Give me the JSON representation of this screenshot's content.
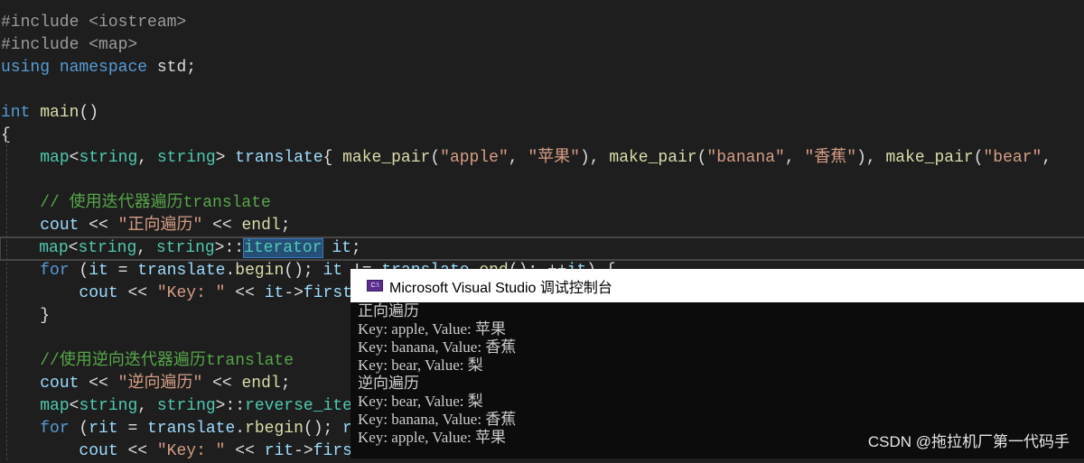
{
  "editor": {
    "lines": [
      [
        [
          "#include <iostream>",
          "pp"
        ]
      ],
      [
        [
          "#include <map>",
          "pp"
        ]
      ],
      [
        [
          "using",
          "kw"
        ],
        [
          " ",
          "pl"
        ],
        [
          "namespace",
          "kw"
        ],
        [
          " std;",
          "pl"
        ]
      ],
      [],
      [
        [
          "int",
          "kw"
        ],
        [
          " ",
          "pl"
        ],
        [
          "main",
          "fn"
        ],
        [
          "()",
          "pl"
        ]
      ],
      [
        [
          "{",
          "pl"
        ]
      ],
      [
        [
          "    ",
          "pl"
        ],
        [
          "map",
          "ty"
        ],
        [
          "<",
          "pl"
        ],
        [
          "string",
          "ty"
        ],
        [
          ", ",
          "pl"
        ],
        [
          "string",
          "ty"
        ],
        [
          "> ",
          "pl"
        ],
        [
          "translate",
          "va"
        ],
        [
          "{ ",
          "pl"
        ],
        [
          "make_pair",
          "fn"
        ],
        [
          "(",
          "pl"
        ],
        [
          "\"apple\"",
          "st"
        ],
        [
          ", ",
          "pl"
        ],
        [
          "\"苹果\"",
          "st"
        ],
        [
          "), ",
          "pl"
        ],
        [
          "make_pair",
          "fn"
        ],
        [
          "(",
          "pl"
        ],
        [
          "\"banana\"",
          "st"
        ],
        [
          ", ",
          "pl"
        ],
        [
          "\"香蕉\"",
          "st"
        ],
        [
          "), ",
          "pl"
        ],
        [
          "make_pair",
          "fn"
        ],
        [
          "(",
          "pl"
        ],
        [
          "\"bear\"",
          "st"
        ],
        [
          ",",
          "pl"
        ]
      ],
      [],
      [
        [
          "    ",
          "pl"
        ],
        [
          "// 使用迭代器遍历translate",
          "cm"
        ]
      ],
      [
        [
          "    ",
          "pl"
        ],
        [
          "cout",
          "va"
        ],
        [
          " << ",
          "pl"
        ],
        [
          "\"正向遍历\"",
          "st"
        ],
        [
          " << ",
          "pl"
        ],
        [
          "endl",
          "fn"
        ],
        [
          ";",
          "pl"
        ]
      ],
      [
        [
          "    ",
          "pl"
        ],
        [
          "map",
          "ty"
        ],
        [
          "<",
          "pl"
        ],
        [
          "string",
          "ty"
        ],
        [
          ", ",
          "pl"
        ],
        [
          "string",
          "ty"
        ],
        [
          ">::",
          "pl"
        ],
        [
          "iterator",
          "ty hl"
        ],
        [
          " ",
          "pl"
        ],
        [
          "it",
          "va"
        ],
        [
          ";",
          "pl"
        ]
      ],
      [
        [
          "    ",
          "pl"
        ],
        [
          "for",
          "kw"
        ],
        [
          " (",
          "pl"
        ],
        [
          "it",
          "va"
        ],
        [
          " = ",
          "pl"
        ],
        [
          "translate",
          "va"
        ],
        [
          ".",
          "pl"
        ],
        [
          "begin",
          "fn"
        ],
        [
          "(); ",
          "pl"
        ],
        [
          "it",
          "va"
        ],
        [
          " != ",
          "pl"
        ],
        [
          "translate",
          "va"
        ],
        [
          ".",
          "pl"
        ],
        [
          "end",
          "fn"
        ],
        [
          "(); ++",
          "pl"
        ],
        [
          "it",
          "va"
        ],
        [
          ") {",
          "pl"
        ]
      ],
      [
        [
          "        ",
          "pl"
        ],
        [
          "cout",
          "va"
        ],
        [
          " << ",
          "pl"
        ],
        [
          "\"Key: \"",
          "st"
        ],
        [
          " << ",
          "pl"
        ],
        [
          "it",
          "va"
        ],
        [
          "->",
          "pl"
        ],
        [
          "first",
          "va"
        ]
      ],
      [
        [
          "    }",
          "pl"
        ]
      ],
      [],
      [
        [
          "    ",
          "pl"
        ],
        [
          "//使用逆向迭代器遍历translate",
          "cm"
        ]
      ],
      [
        [
          "    ",
          "pl"
        ],
        [
          "cout",
          "va"
        ],
        [
          " << ",
          "pl"
        ],
        [
          "\"逆向遍历\"",
          "st"
        ],
        [
          " << ",
          "pl"
        ],
        [
          "endl",
          "fn"
        ],
        [
          ";",
          "pl"
        ]
      ],
      [
        [
          "    ",
          "pl"
        ],
        [
          "map",
          "ty"
        ],
        [
          "<",
          "pl"
        ],
        [
          "string",
          "ty"
        ],
        [
          ", ",
          "pl"
        ],
        [
          "string",
          "ty"
        ],
        [
          ">::",
          "pl"
        ],
        [
          "reverse_ite",
          "ty"
        ]
      ],
      [
        [
          "    ",
          "pl"
        ],
        [
          "for",
          "kw"
        ],
        [
          " (",
          "pl"
        ],
        [
          "rit",
          "va"
        ],
        [
          " = ",
          "pl"
        ],
        [
          "translate",
          "va"
        ],
        [
          ".",
          "pl"
        ],
        [
          "rbegin",
          "fn"
        ],
        [
          "(); ",
          "pl"
        ],
        [
          "r",
          "va"
        ]
      ],
      [
        [
          "        ",
          "pl"
        ],
        [
          "cout",
          "va"
        ],
        [
          " << ",
          "pl"
        ],
        [
          "\"Key: \"",
          "st"
        ],
        [
          " << ",
          "pl"
        ],
        [
          "rit",
          "va"
        ],
        [
          "->",
          "pl"
        ],
        [
          "firs",
          "va"
        ]
      ]
    ]
  },
  "console": {
    "title": "Microsoft Visual Studio 调试控制台",
    "icon": "console-app-icon",
    "icon_text": "C:\\",
    "output": [
      "正向遍历",
      "Key: apple, Value: 苹果",
      "Key: banana, Value: 香蕉",
      "Key: bear, Value: 梨",
      "逆向遍历",
      "Key: bear, Value: 梨",
      "Key: banana, Value: 香蕉",
      "Key: apple, Value: 苹果"
    ]
  },
  "watermark": "CSDN @拖拉机厂第一代码手",
  "colors": {
    "background": "#1e1e1e",
    "keyword": "#569cd6",
    "type": "#4ec9b0",
    "function": "#dcdcaa",
    "string": "#d69d85",
    "comment": "#57a64a",
    "console_bg": "#0c0c0c"
  }
}
